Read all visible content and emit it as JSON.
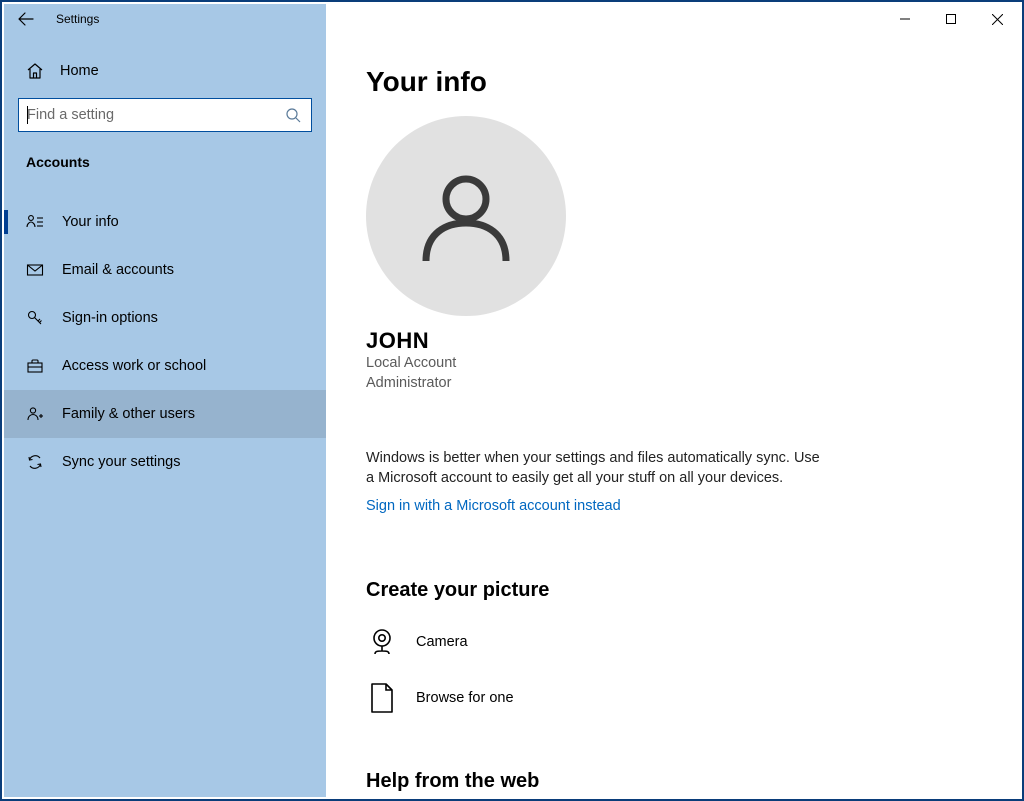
{
  "window": {
    "title": "Settings"
  },
  "sidebar": {
    "home_label": "Home",
    "search_placeholder": "Find a setting",
    "section_title": "Accounts",
    "items": [
      {
        "label": "Your info"
      },
      {
        "label": "Email & accounts"
      },
      {
        "label": "Sign-in options"
      },
      {
        "label": "Access work or school"
      },
      {
        "label": "Family & other users"
      },
      {
        "label": "Sync your settings"
      }
    ]
  },
  "main": {
    "page_title": "Your info",
    "username": "JOHN",
    "account_type": "Local Account",
    "role": "Administrator",
    "sync_blurb": "Windows is better when your settings and files automatically sync. Use a Microsoft account to easily get all your stuff on all your devices.",
    "signin_link": "Sign in with a Microsoft account instead",
    "create_picture_heading": "Create your picture",
    "camera_label": "Camera",
    "browse_label": "Browse for one",
    "help_heading": "Help from the web"
  }
}
